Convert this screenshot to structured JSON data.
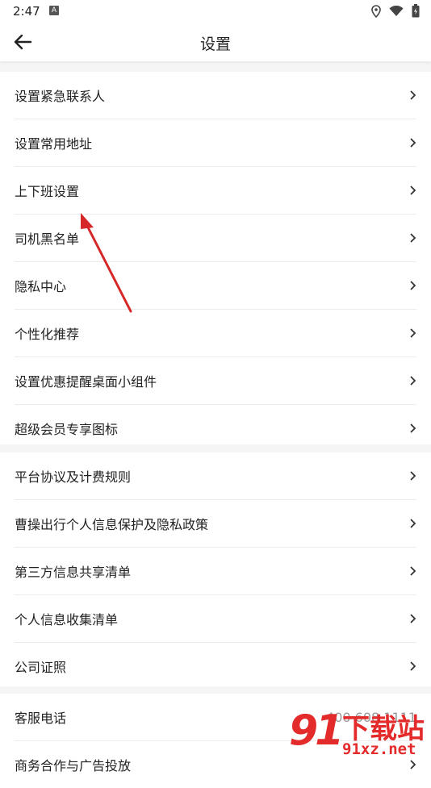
{
  "status_bar": {
    "time": "2:47",
    "notif_letter": "A"
  },
  "header": {
    "title": "设置"
  },
  "sections": [
    {
      "items": [
        {
          "label": "设置紧急联系人"
        },
        {
          "label": "设置常用地址"
        },
        {
          "label": "上下班设置"
        },
        {
          "label": "司机黑名单"
        },
        {
          "label": "隐私中心"
        },
        {
          "label": "个性化推荐"
        },
        {
          "label": "设置优惠提醒桌面小组件"
        },
        {
          "label": "超级会员专享图标"
        }
      ]
    },
    {
      "items": [
        {
          "label": "平台协议及计费规则"
        },
        {
          "label": "曹操出行个人信息保护及隐私政策"
        },
        {
          "label": "第三方信息共享清单"
        },
        {
          "label": "个人信息收集清单"
        },
        {
          "label": "公司证照"
        }
      ]
    },
    {
      "items": [
        {
          "label": "客服电话",
          "value": "400 608 1111"
        },
        {
          "label": "商务合作与广告投放"
        }
      ]
    }
  ],
  "watermark": {
    "number": "91",
    "text": "下载站",
    "domain": "91xz.net"
  },
  "colors": {
    "annotation_arrow": "#d62828",
    "watermark": "#e32b2b",
    "separator": "#f5f5f5"
  }
}
